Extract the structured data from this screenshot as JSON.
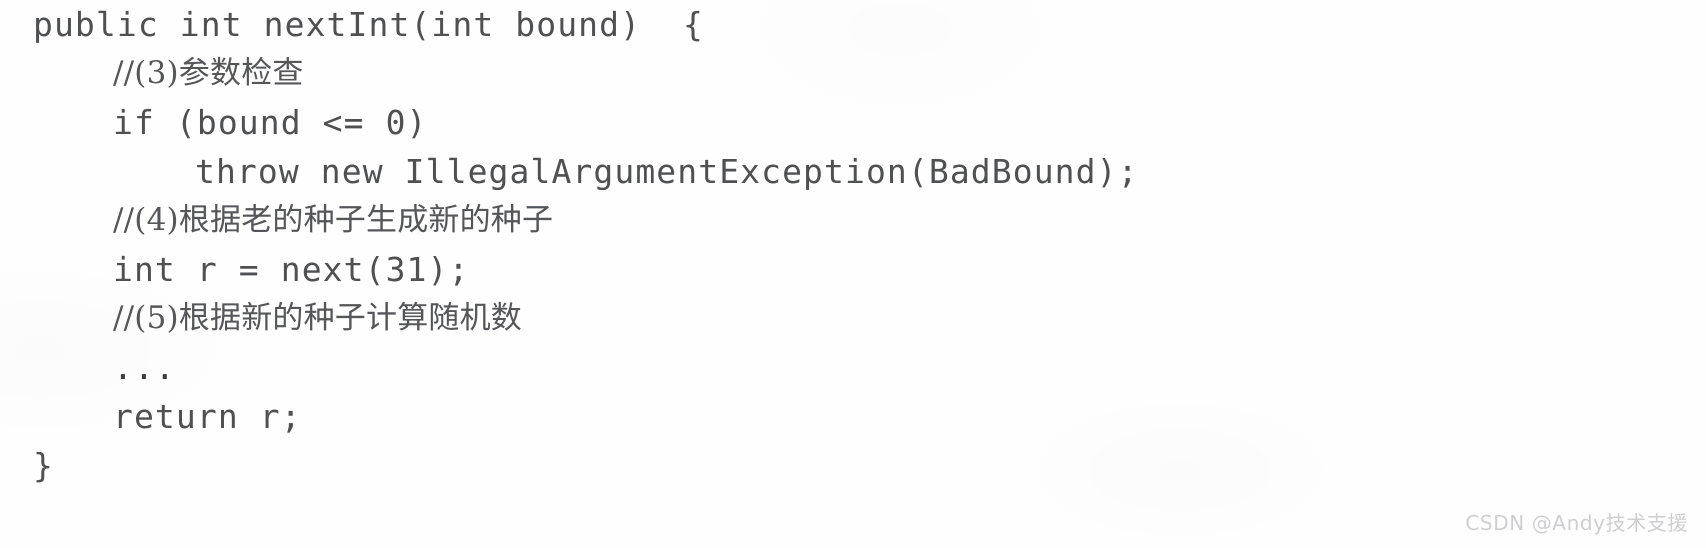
{
  "document": {
    "kind": "scanned-code-listing",
    "language": "Java",
    "background_color": "#fefefe",
    "text_color": "#4f5052",
    "code_lines": [
      {
        "indent": 0,
        "style": "code",
        "text": "public int nextInt(int bound)  {"
      },
      {
        "indent": 1,
        "style": "comment",
        "text": "//(3)参数检查"
      },
      {
        "indent": 1,
        "style": "code",
        "text": "if (bound <= 0)"
      },
      {
        "indent": 2,
        "style": "code",
        "text": "throw new IllegalArgumentException(BadBound);"
      },
      {
        "indent": 1,
        "style": "comment",
        "text": "//(4)根据老的种子生成新的种子"
      },
      {
        "indent": 1,
        "style": "code",
        "text": "int r = next(31);"
      },
      {
        "indent": 1,
        "style": "comment",
        "text": "//(5)根据新的种子计算随机数"
      },
      {
        "indent": 1,
        "style": "dots",
        "text": "..."
      },
      {
        "indent": 1,
        "style": "code",
        "text": "return r;"
      },
      {
        "indent": 0,
        "style": "code",
        "text": "}"
      }
    ]
  },
  "watermark": {
    "text": "CSDN @Andy技术支援",
    "color": "#cfcfd2"
  }
}
